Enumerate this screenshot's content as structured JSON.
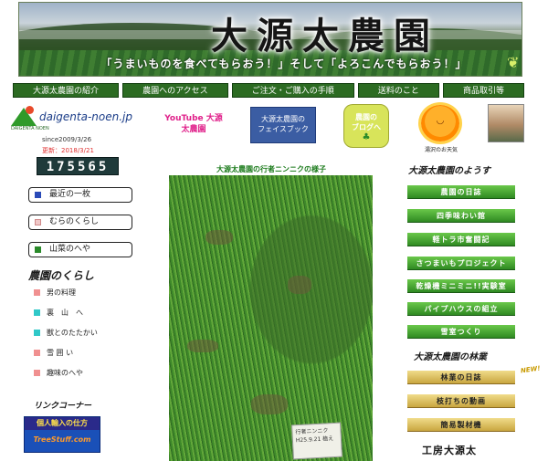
{
  "banner": {
    "title": "大源太農園",
    "slogan": "「うまいものを食べてもらおう！」そして「よろこんでもらおう！」",
    "leaf_icon": "leaf-icon"
  },
  "nav": [
    "大源太農園の紹介",
    "農園へのアクセス",
    "ご注文・ご購入の手順",
    "送料のこと",
    "商品取引等"
  ],
  "logo": {
    "text": "daigenta-noen.jp",
    "sub": "DAIGENTA NOEN"
  },
  "links": {
    "youtube": "YouTube 大源太農園",
    "facebook_line1": "大源太農園の",
    "facebook_line2": "フェイスブック",
    "blog_line1": "農園の",
    "blog_line2": "ブログへ",
    "weather": "湯沢のお天気"
  },
  "meta": {
    "since": "since2009/3/26",
    "updated": "更新：2018/3/21",
    "counter": "175565"
  },
  "left_buttons": [
    "最近の一枚",
    "むらのくらし",
    "山菜のへや"
  ],
  "life": {
    "heading": "農園のくらし",
    "items": [
      "男の料理",
      "裏　山　へ",
      "獣とのたたかい",
      "雪 囲 い",
      "趣味のへや"
    ]
  },
  "link_corner": {
    "heading": "リンクコーナー",
    "import_title": "個人輸入の仕方",
    "import_site": "TreeStuff.com"
  },
  "photo": {
    "caption": "大源太農園の行者ニンニクの様子",
    "sign": "行者ニンニク H25.9.21 植え"
  },
  "right": {
    "heading1": "大源太農園のようす",
    "green_buttons": [
      "農園の日誌",
      "四季味わい館",
      "軽トラ市奮闘記",
      "さつまいもプロジェクト",
      "乾燥機ミニミニ!!実験室",
      "パイプハウスの組立",
      "雪室つくり"
    ],
    "heading2": "大源太農園の林業",
    "new_badge": "NEW!",
    "gold_buttons": [
      "林業の日誌",
      "枝打ちの動画",
      "簡易製材機"
    ],
    "workshop": "工房大源太"
  },
  "colors": {
    "nav_green": "#2c6b22",
    "button_green": "#2f8a22",
    "button_gold": "#c9a640",
    "counter_bg": "#1f3a3a",
    "updated_red": "#e03030"
  }
}
